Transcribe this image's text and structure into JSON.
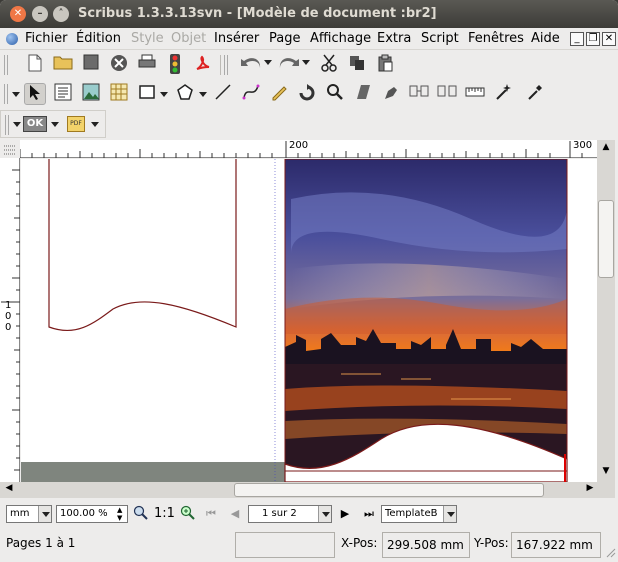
{
  "window": {
    "title": "Scribus 1.3.3.13svn - [Modèle de document :br2]"
  },
  "menubar": {
    "items": [
      "Fichier",
      "Édition",
      "Style",
      "Objet",
      "Insérer",
      "Page",
      "Affichage",
      "Extra",
      "Script",
      "Fenêtres",
      "Aide"
    ],
    "disabled": [
      "Style",
      "Objet"
    ]
  },
  "toolbar3": {
    "ok_label": "OK",
    "pdf_label": "PDF"
  },
  "rulers": {
    "top_labels": [
      "200",
      "300"
    ],
    "left_label": "100"
  },
  "nav": {
    "unit": "mm",
    "zoom": "100.00 %",
    "zoom_reset": "1:1",
    "page_indicator": "1 sur 2",
    "template": "TemplateB"
  },
  "status": {
    "pages": "Pages 1 à 1",
    "xpos_label": "X-Pos:",
    "xpos_value": "299.508 mm",
    "ypos_label": "Y-Pos:",
    "ypos_value": "167.922 mm"
  },
  "colors": {
    "shape_stroke": "#7a1a1a",
    "margin_guide": "#4040c0",
    "gray_band": "#7f857e"
  }
}
